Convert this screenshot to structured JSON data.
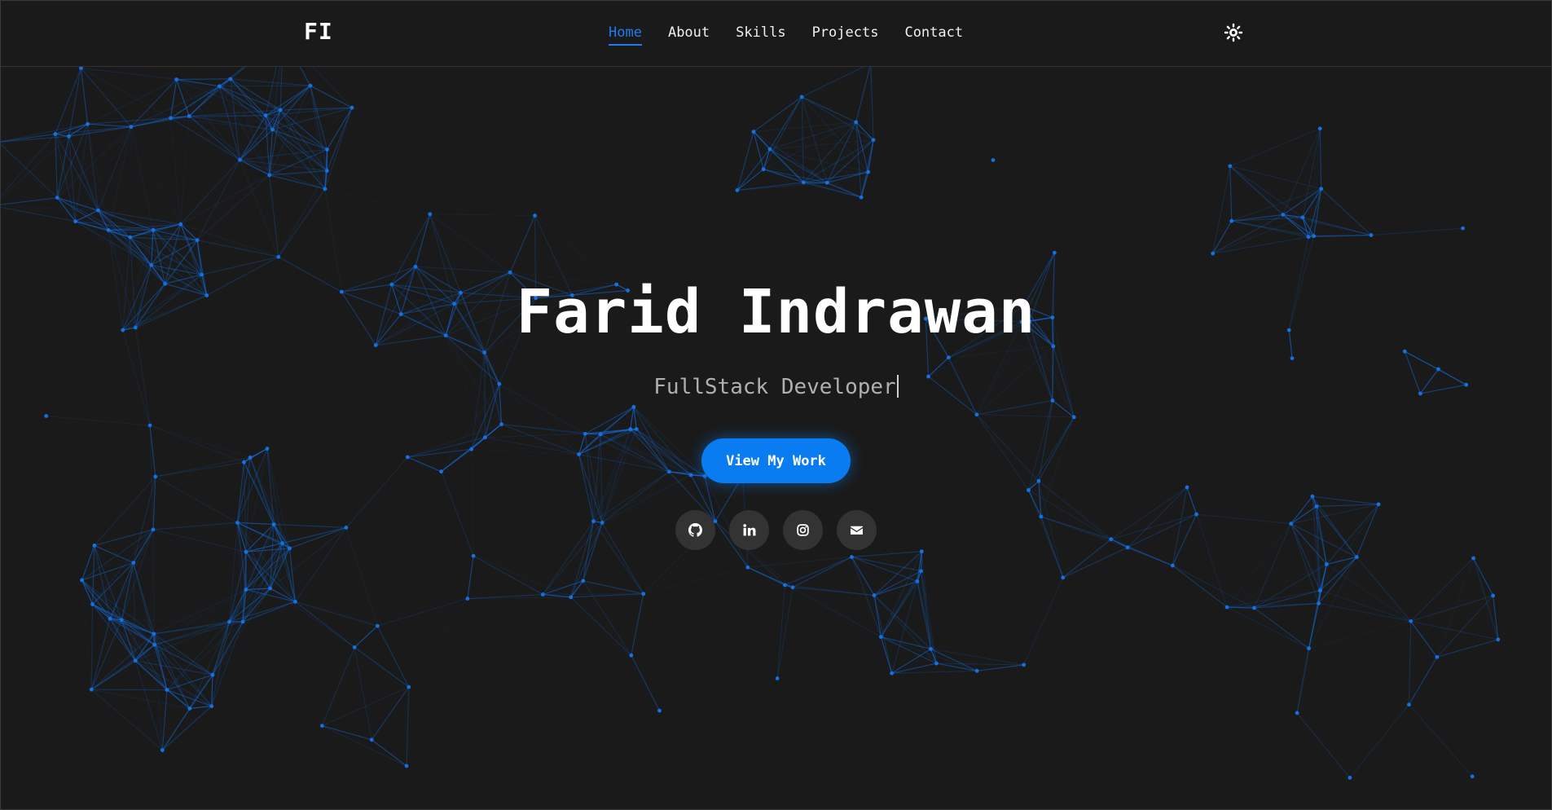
{
  "header": {
    "logo": "FI",
    "nav": [
      "Home",
      "About",
      "Skills",
      "Projects",
      "Contact"
    ],
    "active_nav": "Home",
    "theme_toggle_icon": "sun-icon"
  },
  "hero": {
    "name": "Farid Indrawan",
    "role": "FullStack Developer",
    "cta_label": "View My Work",
    "socials": [
      {
        "name": "github",
        "icon": "github-icon"
      },
      {
        "name": "linkedin",
        "icon": "linkedin-icon"
      },
      {
        "name": "instagram",
        "icon": "instagram-icon"
      },
      {
        "name": "email",
        "icon": "envelope-icon"
      }
    ]
  },
  "colors": {
    "background": "#1a1a1a",
    "accent": "#0a7cf2",
    "text": "#ffffff",
    "muted_text": "#b0b0b0",
    "social_bg": "#333333"
  }
}
